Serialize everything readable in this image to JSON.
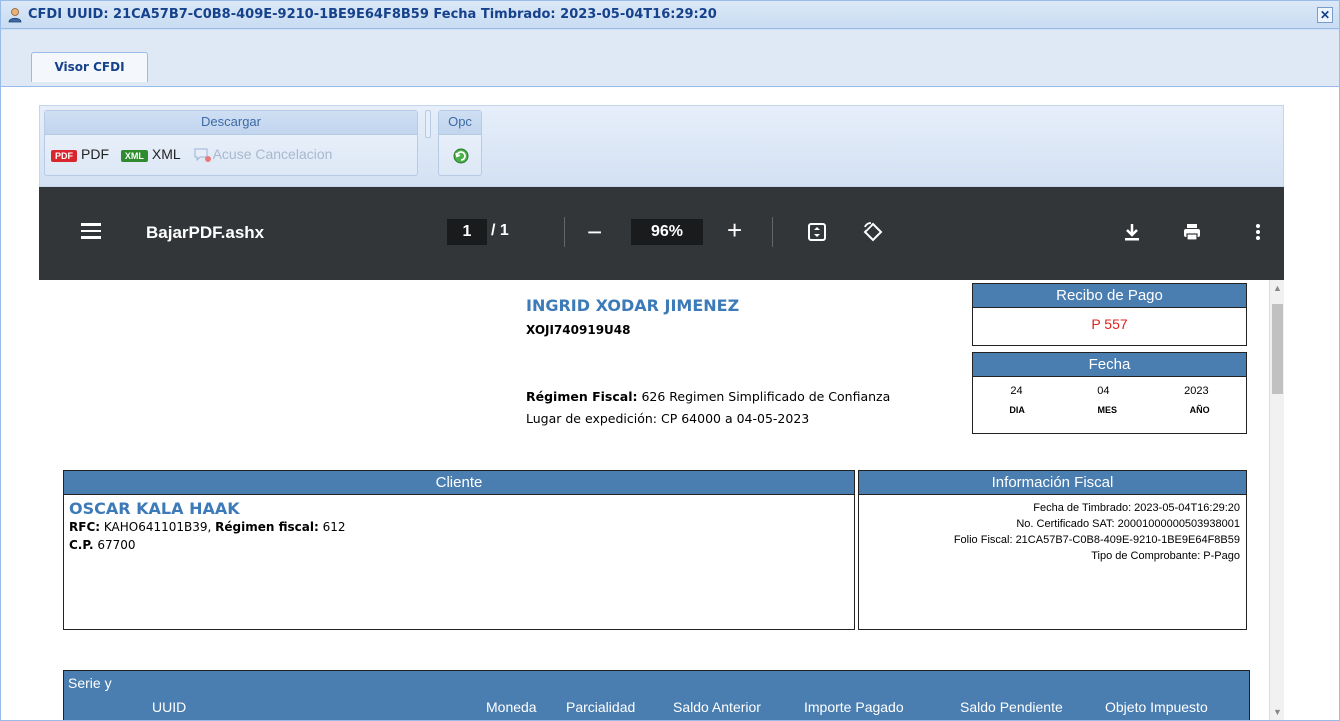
{
  "window": {
    "title": "CFDI UUID: 21CA57B7-C0B8-409E-9210-1BE9E64F8B59 Fecha Timbrado: 2023-05-04T16:29:20",
    "close_label": "✕"
  },
  "tabs": [
    {
      "label": "Visor CFDI",
      "active": true
    }
  ],
  "toolbar": {
    "descargar": {
      "title": "Descargar",
      "pdf_badge": "PDF",
      "pdf_label": "PDF",
      "xml_badge": "XML",
      "xml_label": "XML",
      "acuse_label": "Acuse Cancelacion"
    },
    "opc": {
      "title": "Opc",
      "refresh_icon": "refresh-icon"
    }
  },
  "viewer": {
    "filename": "BajarPDF.ashx",
    "page_current": "1",
    "page_total": "/ 1",
    "zoom": "96%",
    "minus": "−",
    "plus": "+"
  },
  "document": {
    "issuer_name": "INGRID XODAR JIMENEZ",
    "issuer_rfc": "XOJI740919U48",
    "regimen_label": "Régimen Fiscal:",
    "regimen_value": " 626 Regimen Simplificado de Confianza",
    "lugar": "Lugar de expedición: CP 64000 a 04-05-2023",
    "recibo_title": "Recibo de Pago",
    "recibo_value": "P 557",
    "fecha_title": "Fecha",
    "fecha_values": {
      "dia": "24",
      "mes": "04",
      "anio": "2023"
    },
    "fecha_labels": {
      "dia": "DIA",
      "mes": "MES",
      "anio": "AÑO"
    },
    "cliente": {
      "title": "Cliente",
      "name": "OSCAR KALA HAAK",
      "rfc_label": "RFC:",
      "rfc_value": " KAHO641101B39, ",
      "regimen_label": "Régimen fiscal:",
      "regimen_value": " 612",
      "cp_label": "C.P.",
      "cp_value": " 67700"
    },
    "info_fiscal": {
      "title": "Información Fiscal",
      "lines": [
        "Fecha de Timbrado: 2023-05-04T16:29:20",
        "No. Certificado SAT: 20001000000503938001",
        "Folio Fiscal: 21CA57B7-C0B8-409E-9210-1BE9E64F8B59",
        "Tipo de Comprobante: P-Pago"
      ]
    },
    "table_headers": [
      "Serie y",
      "UUID",
      "Moneda",
      "Parcialidad",
      "Saldo Anterior",
      "Importe Pagado",
      "Saldo Pendiente",
      "Objeto Impuesto"
    ]
  },
  "colors": {
    "accent": "#4a7db0",
    "title_text": "#15428b",
    "recibo_red": "#e0221f"
  }
}
